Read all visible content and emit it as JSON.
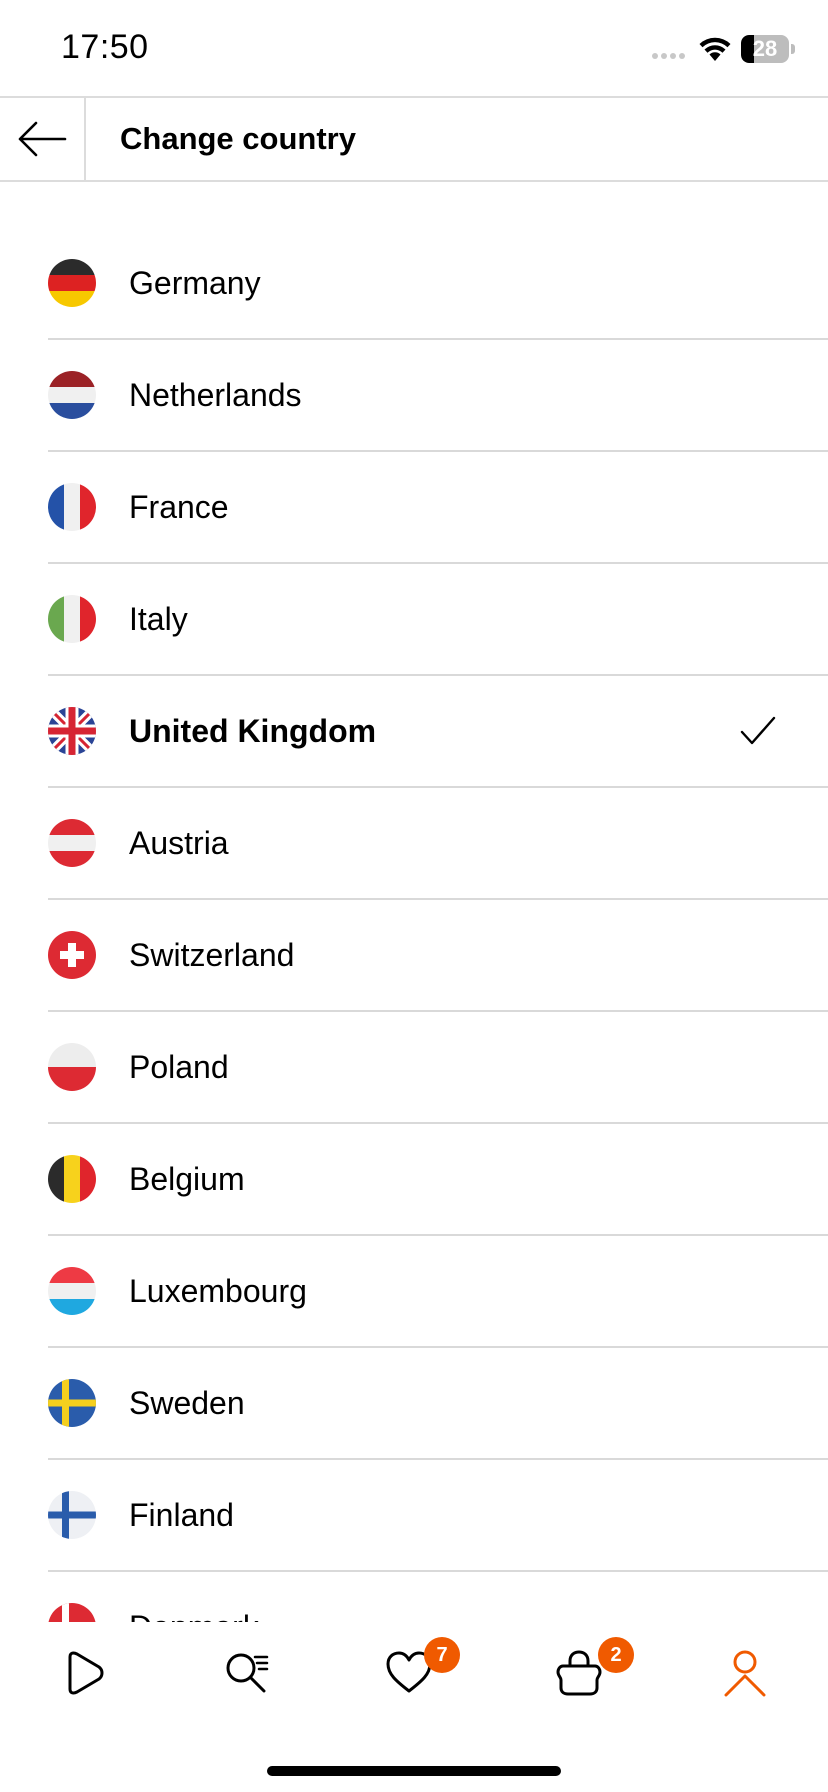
{
  "status_bar": {
    "time": "17:50",
    "battery_percent": "28",
    "battery_level": 0.28
  },
  "header": {
    "back_icon": "arrow-left-icon",
    "title": "Change country"
  },
  "countries": [
    {
      "name": "Germany",
      "flag": "germany-flag-icon",
      "selected": false
    },
    {
      "name": "Netherlands",
      "flag": "netherlands-flag-icon",
      "selected": false
    },
    {
      "name": "France",
      "flag": "france-flag-icon",
      "selected": false
    },
    {
      "name": "Italy",
      "flag": "italy-flag-icon",
      "selected": false
    },
    {
      "name": "United Kingdom",
      "flag": "uk-flag-icon",
      "selected": true
    },
    {
      "name": "Austria",
      "flag": "austria-flag-icon",
      "selected": false
    },
    {
      "name": "Switzerland",
      "flag": "switzerland-flag-icon",
      "selected": false
    },
    {
      "name": "Poland",
      "flag": "poland-flag-icon",
      "selected": false
    },
    {
      "name": "Belgium",
      "flag": "belgium-flag-icon",
      "selected": false
    },
    {
      "name": "Luxembourg",
      "flag": "luxembourg-flag-icon",
      "selected": false
    },
    {
      "name": "Sweden",
      "flag": "sweden-flag-icon",
      "selected": false
    },
    {
      "name": "Finland",
      "flag": "finland-flag-icon",
      "selected": false
    },
    {
      "name": "Denmark",
      "flag": "denmark-flag-icon",
      "selected": false
    }
  ],
  "tab_bar": {
    "tabs": [
      {
        "name": "home",
        "icon": "play-home-icon"
      },
      {
        "name": "search",
        "icon": "search-list-icon"
      },
      {
        "name": "wishlist",
        "icon": "heart-icon",
        "badge": "7"
      },
      {
        "name": "cart",
        "icon": "shopping-bag-icon",
        "badge": "2"
      },
      {
        "name": "profile",
        "icon": "person-icon",
        "active": true
      }
    ]
  },
  "colors": {
    "accent": "#f05a00",
    "divider": "#d9d9d9"
  }
}
